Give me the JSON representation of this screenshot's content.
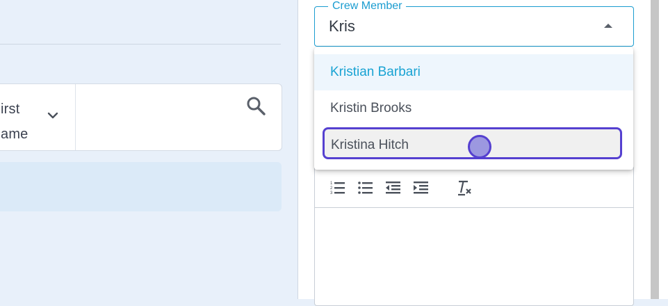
{
  "filters": {
    "column_label_line1": "irst",
    "column_label_line2": "ame"
  },
  "crew_member": {
    "legend": "Crew Member",
    "value": "Kris",
    "options": [
      {
        "label": "Kristian Barbari",
        "state": "active"
      },
      {
        "label": "Kristin Brooks",
        "state": "normal"
      },
      {
        "label": "Kristina Hitch",
        "state": "hovered"
      }
    ]
  },
  "editor_toolbar": {
    "icons": [
      "ordered-list-icon",
      "bullet-list-icon",
      "outdent-icon",
      "indent-icon",
      "clear-format-icon"
    ]
  },
  "colors": {
    "accent": "#1a9cd0",
    "highlight_border": "#5540d0",
    "active_option_text": "#19a3d3"
  }
}
